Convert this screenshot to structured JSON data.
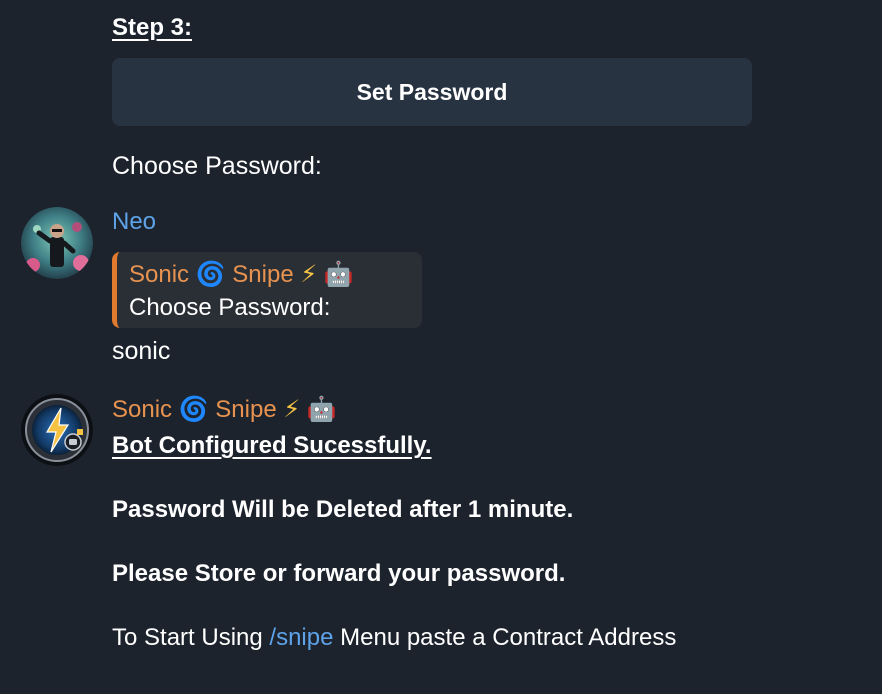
{
  "step": {
    "title": "Step 3:"
  },
  "inline_button": {
    "label": "Set Password"
  },
  "prompt": {
    "text": "Choose Password:"
  },
  "user_message": {
    "sender": "Neo",
    "reply": {
      "sender_name_1": "Sonic",
      "sender_name_2": "Snipe",
      "text": "Choose Password:"
    },
    "text": "sonic"
  },
  "bot_message": {
    "sender_name_1": "Sonic",
    "sender_name_2": "Snipe",
    "line1": "Bot Configured Sucessfully.",
    "line2": "Password Will be Deleted after 1 minute.",
    "line3": "Please Store or forward your password.",
    "line4_before": "To Start Using",
    "line4_link": "/snipe",
    "line4_after": "Menu paste a Contract Address"
  },
  "icons": {
    "swirl": "cyclone-emoji",
    "bolt": "lightning-emoji",
    "robot": "robot-emoji"
  },
  "colors": {
    "background": "#1c232d",
    "button": "#283341",
    "sender_blue": "#5ea2e8",
    "sender_orange": "#e8924f",
    "reply_accent": "#e07a2f"
  }
}
